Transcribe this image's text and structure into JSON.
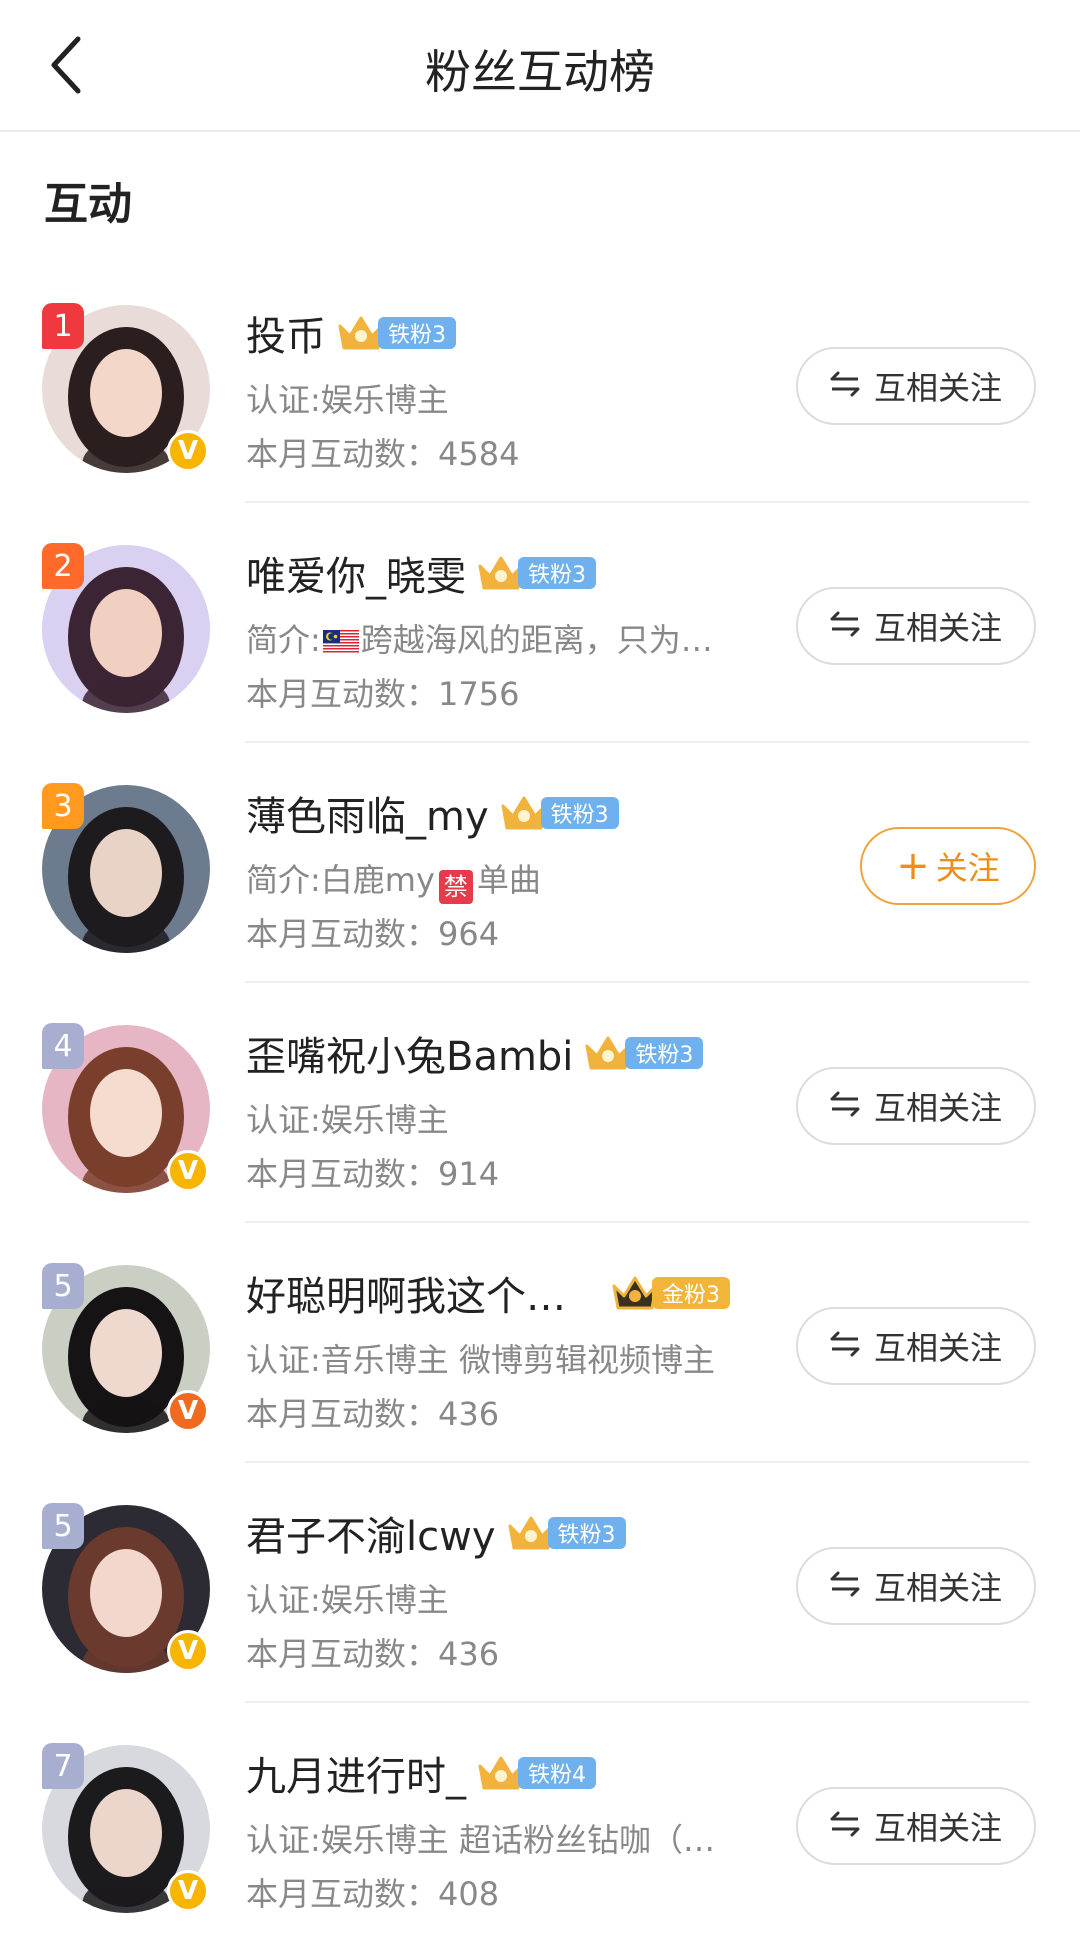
{
  "header": {
    "title": "粉丝互动榜",
    "back_icon": "chevron-left-icon"
  },
  "section": {
    "title": "互动"
  },
  "rows": [
    {
      "rank": "1",
      "rank_color": "#f0393f",
      "name": "投币",
      "fan_level": "铁粉3",
      "fan_type": "iron",
      "verified": true,
      "verified_color": "#f7b500",
      "sub": "认证:娱乐博主",
      "count": "本月互动数：4584",
      "button": "互相关注",
      "button_type": "mutual",
      "avatar_palette": [
        "#e9dcd8",
        "#2a1e1e",
        "#f3d7c9"
      ]
    },
    {
      "rank": "2",
      "rank_color": "#ff6a2b",
      "name": "唯爱你_晓雯",
      "fan_level": "铁粉3",
      "fan_type": "iron",
      "verified": false,
      "sub_prefix": "简介:",
      "sub_suffix": "跨越海风的距离，只为…",
      "count": "本月互动数：1756",
      "button": "互相关注",
      "button_type": "mutual",
      "avatar_palette": [
        "#d9d0f2",
        "#3b2433",
        "#f1d0c2"
      ]
    },
    {
      "rank": "3",
      "rank_color": "#ff9a1f",
      "name": "薄色雨临_my",
      "fan_level": "铁粉3",
      "fan_type": "iron",
      "verified": false,
      "sub_prefix": "简介:白鹿my",
      "sub_ban": "禁",
      "sub_suffix": "单曲",
      "count": "本月互动数：964",
      "button": "关注",
      "button_plus": "+",
      "button_type": "follow",
      "avatar_palette": [
        "#6c7c8e",
        "#1d1b1e",
        "#e9d2c6"
      ]
    },
    {
      "rank": "4",
      "rank_color": "#a8aed0",
      "name": "歪嘴祝小兔Bambi",
      "fan_level": "铁粉3",
      "fan_type": "iron",
      "verified": true,
      "verified_color": "#f7b500",
      "sub": "认证:娱乐博主",
      "count": "本月互动数：914",
      "button": "互相关注",
      "button_type": "mutual",
      "avatar_palette": [
        "#e6b6c4",
        "#7a3f2c",
        "#f6dccf"
      ]
    },
    {
      "rank": "5",
      "rank_color": "#a8aed0",
      "name": "好聪明啊我这个…",
      "fan_level": "金粉3",
      "fan_type": "gold",
      "verified": true,
      "verified_color": "#f06a20",
      "sub": "认证:音乐博主 微博剪辑视频博主",
      "count": "本月互动数：436",
      "button": "互相关注",
      "button_type": "mutual",
      "avatar_palette": [
        "#c9cfc3",
        "#151314",
        "#efd8cd"
      ]
    },
    {
      "rank": "5",
      "rank_color": "#a8aed0",
      "name": "君子不渝lcwy",
      "fan_level": "铁粉3",
      "fan_type": "iron",
      "verified": true,
      "verified_color": "#f7b500",
      "sub": "认证:娱乐博主",
      "count": "本月互动数：436",
      "button": "互相关注",
      "button_type": "mutual",
      "avatar_palette": [
        "#2c2a33",
        "#6b3a2e",
        "#f3d6cc"
      ]
    },
    {
      "rank": "7",
      "rank_color": "#a8aed0",
      "name": "九月进行时_",
      "fan_level": "铁粉4",
      "fan_type": "iron",
      "verified": true,
      "verified_color": "#f7b500",
      "sub": "认证:娱乐博主 超话粉丝钻咖（…",
      "count": "本月互动数：408",
      "button": "互相关注",
      "button_type": "mutual",
      "avatar_palette": [
        "#d7d9de",
        "#1b1a1d",
        "#ecd5ca"
      ]
    }
  ],
  "colors": {
    "iron_pill": "#6fb1ef",
    "gold_pill": "#f3b43a",
    "crown": "#f2b33d"
  }
}
